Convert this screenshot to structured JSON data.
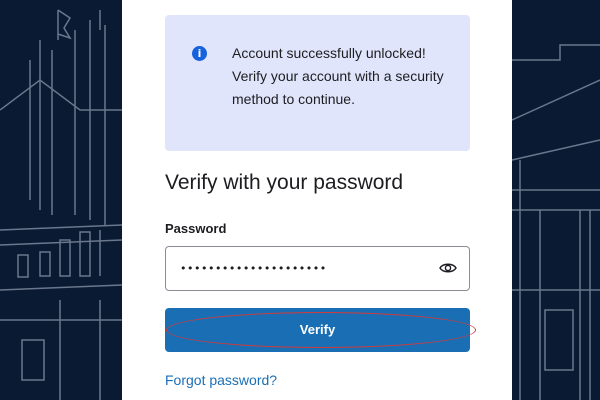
{
  "alert": {
    "icon": "info-icon",
    "icon_glyph": "i",
    "message": "Account successfully unlocked! Verify your account with a security method to continue."
  },
  "form": {
    "heading": "Verify with your password",
    "password_label": "Password",
    "password_masked": "•••••••••••••••••••••",
    "show_password_icon": "eye-icon",
    "verify_label": "Verify",
    "forgot_password_label": "Forgot password?"
  },
  "colors": {
    "background": "#0a1a33",
    "alert_background": "#e0e5fb",
    "info_icon": "#1662dd",
    "primary_button": "#1a6fb4",
    "link": "#1a6fb4",
    "highlight_annotation": "#d23a3a"
  }
}
